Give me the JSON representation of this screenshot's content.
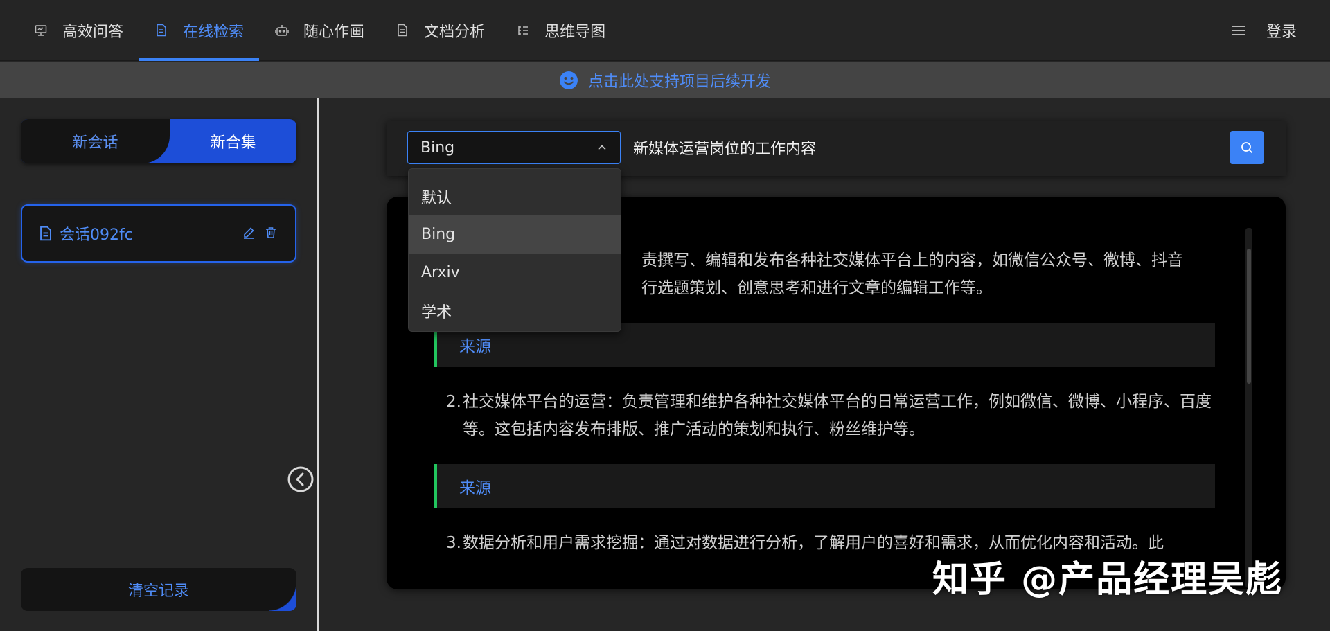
{
  "nav": {
    "items": [
      {
        "label": "高效问答",
        "icon": "monitor-icon",
        "active": false
      },
      {
        "label": "在线检索",
        "icon": "document-icon",
        "active": true
      },
      {
        "label": "随心作画",
        "icon": "robot-icon",
        "active": false
      },
      {
        "label": "文档分析",
        "icon": "document-icon",
        "active": false
      },
      {
        "label": "思维导图",
        "icon": "list-tree-icon",
        "active": false
      }
    ],
    "login": "登录"
  },
  "banner": {
    "text": "点击此处支持项目后续开发",
    "icon": "smile-icon"
  },
  "sidebar": {
    "new_session": "新会话",
    "new_collection": "新合集",
    "sessions": [
      {
        "title": "会话092fc"
      }
    ],
    "clear": "清空记录"
  },
  "search": {
    "engine": "Bing",
    "query": "新媒体运营岗位的工作内容",
    "engine_options": [
      "默认",
      "Bing",
      "Arxiv",
      "学术"
    ]
  },
  "result": {
    "p1_line1": "责撰写、编辑和发布各种社交媒体平台上的内容，如微信公众号、微博、抖音",
    "p1_line2": "行选题策划、创意思考和进行文章的编辑工作等。",
    "source_label": "来源",
    "items": [
      {
        "num": "2.",
        "text": "社交媒体平台的运营：负责管理和维护各种社交媒体平台的日常运营工作，例如微信、微博、小程序、百度等。这包括内容发布排版、推广活动的策划和执行、粉丝维护等。"
      },
      {
        "num": "3.",
        "text": "数据分析和用户需求挖掘：通过对数据进行分析，了解用户的喜好和需求，从而优化内容和活动。此"
      }
    ]
  },
  "watermark": "知乎 @产品经理吴彪",
  "colors": {
    "accent": "#3b82f6",
    "source_bar": "#22c55e"
  }
}
